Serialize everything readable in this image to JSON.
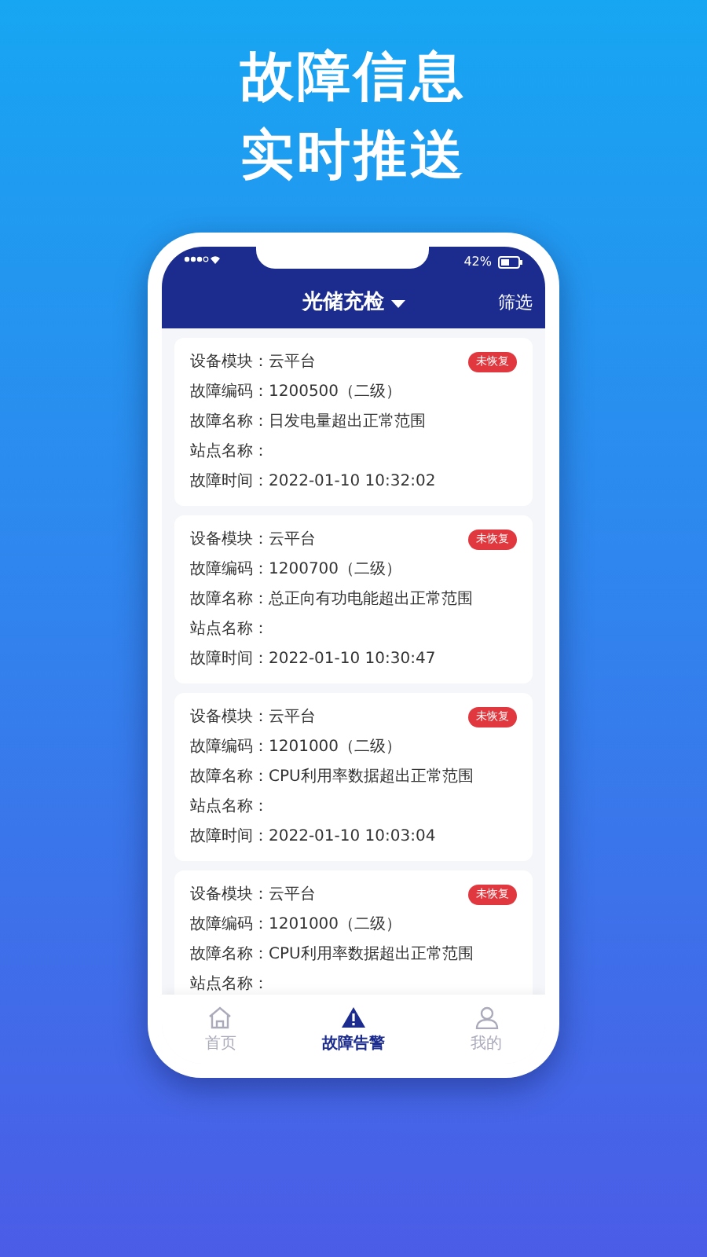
{
  "headline": [
    "故障信息",
    "实时推送"
  ],
  "status_bar": {
    "battery_text": "42%"
  },
  "header": {
    "title": "光储充检",
    "action": "筛选"
  },
  "faults": [
    {
      "badge": "未恢复",
      "fields": [
        {
          "label": "设备模块：",
          "value": "云平台"
        },
        {
          "label": "故障编码：",
          "value": "1200500（二级）"
        },
        {
          "label": "故障名称：",
          "value": "日发电量超出正常范围"
        },
        {
          "label": "站点名称："
        },
        {
          "label": "故障时间：",
          "value": "2022-01-10 10:32:02"
        }
      ]
    },
    {
      "badge": "未恢复",
      "fields": [
        {
          "label": "设备模块：",
          "value": "云平台"
        },
        {
          "label": "故障编码：",
          "value": "1200700（二级）"
        },
        {
          "label": "故障名称：",
          "value": "总正向有功电能超出正常范围"
        },
        {
          "label": "站点名称："
        },
        {
          "label": "故障时间：",
          "value": "2022-01-10 10:30:47"
        }
      ]
    },
    {
      "badge": "未恢复",
      "fields": [
        {
          "label": "设备模块：",
          "value": "云平台"
        },
        {
          "label": "故障编码：",
          "value": "1201000（二级）"
        },
        {
          "label": "故障名称：",
          "value": "CPU利用率数据超出正常范围"
        },
        {
          "label": "站点名称："
        },
        {
          "label": "故障时间：",
          "value": "2022-01-10 10:03:04"
        }
      ]
    },
    {
      "badge": "未恢复",
      "fields": [
        {
          "label": "设备模块：",
          "value": "云平台"
        },
        {
          "label": "故障编码：",
          "value": "1201000（二级）"
        },
        {
          "label": "故障名称：",
          "value": "CPU利用率数据超出正常范围"
        },
        {
          "label": "站点名称："
        }
      ]
    }
  ],
  "tab_bar": [
    {
      "kind": "home",
      "label": "首页",
      "selected": false
    },
    {
      "kind": "alert",
      "label": "故障告警",
      "selected": true
    },
    {
      "kind": "user",
      "label": "我的",
      "selected": false
    }
  ]
}
